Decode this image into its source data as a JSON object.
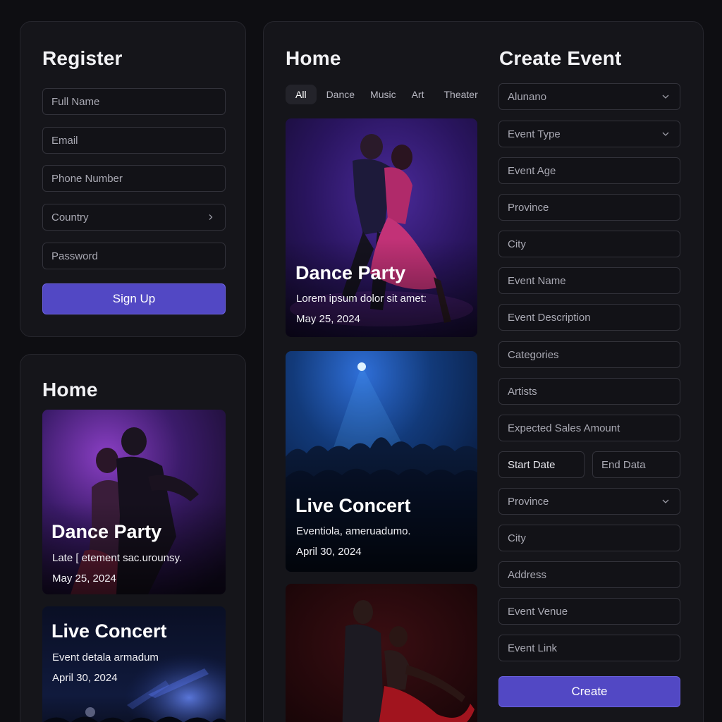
{
  "register": {
    "title": "Register",
    "fields": [
      "Full Name",
      "Email",
      "Phone Number",
      "Country",
      "Password"
    ],
    "submit": "Sign Up"
  },
  "home_left": {
    "title": "Home",
    "cards": [
      {
        "title": "Dance Party",
        "desc": "Late [ etement sac.urounsy.",
        "date": "May 25, 2024"
      },
      {
        "title": "Live Concert",
        "desc": "Event detala armadum",
        "date": "April 30, 2024"
      }
    ]
  },
  "home_mid": {
    "title": "Home",
    "tabs": [
      "All",
      "Dance",
      "Music",
      "Art",
      "Theater"
    ],
    "active_tab": "All",
    "cards": [
      {
        "title": "Dance Party",
        "desc": "Lorem ipsum dolor sit amet:",
        "date": "May 25, 2024"
      },
      {
        "title": "Live Concert",
        "desc": "Eventiola, ameruadumo.",
        "date": "April 30, 2024"
      }
    ]
  },
  "create_event": {
    "title": "Create Event",
    "fields": {
      "f1": "Alunano",
      "f2": "Event Type",
      "f3": "Event Age",
      "f4": "Province",
      "f5": "City",
      "f6": "Event Name",
      "f7": "Event Description",
      "f8": "Categories",
      "f9": "Artists",
      "f10": "Expected Sales Amount",
      "start": "Start Date",
      "end": "End Data",
      "f11": "Province",
      "f12": "City",
      "f13": "Address",
      "f14": "Event Venue",
      "f15": "Event Link"
    },
    "submit": "Create"
  },
  "colors": {
    "accent": "#5248c4",
    "background": "#0e0e12",
    "panel": "#15151a"
  }
}
